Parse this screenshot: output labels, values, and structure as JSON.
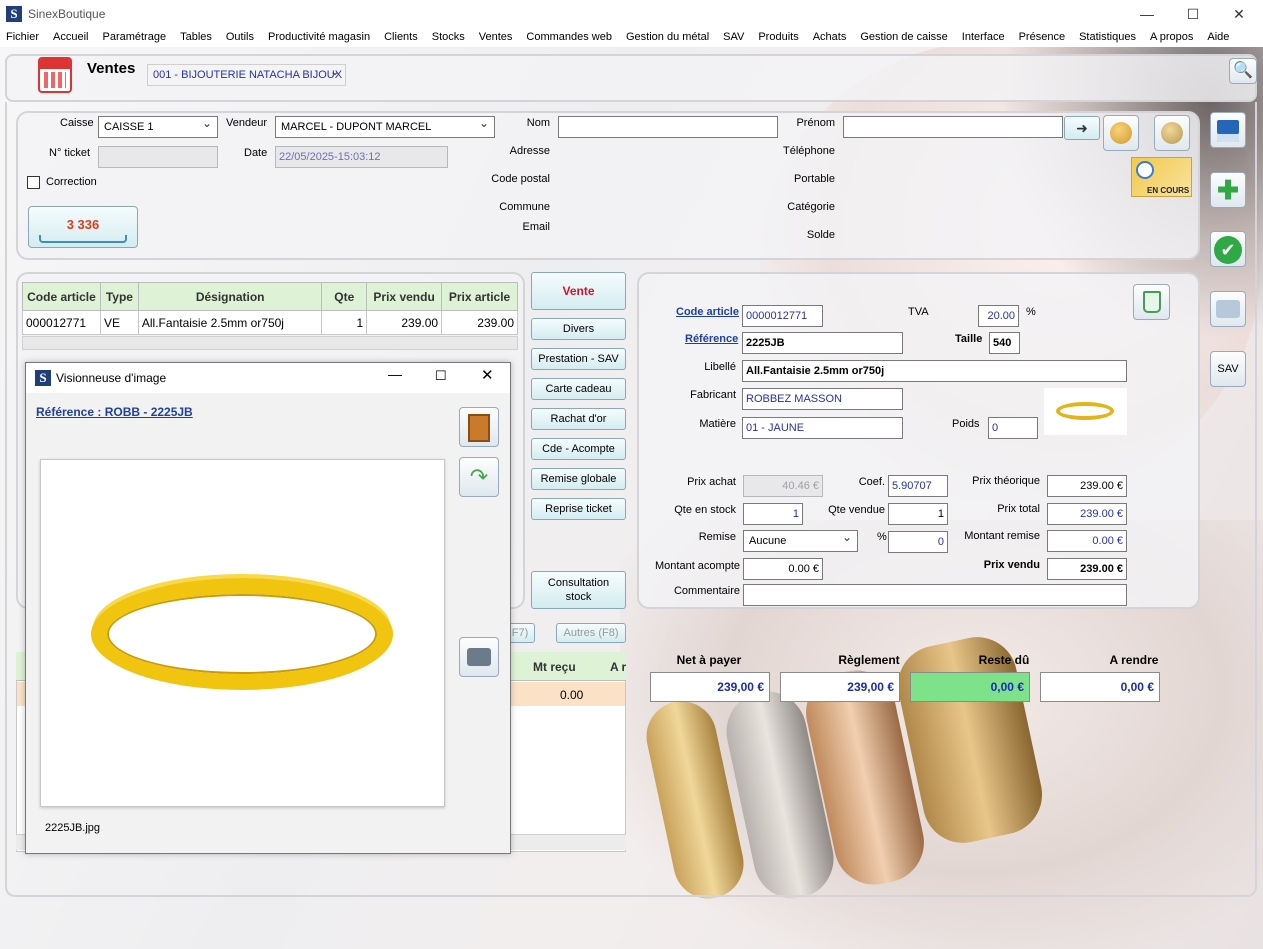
{
  "window": {
    "app_title": "SinexBoutique",
    "minimize": "—",
    "maximize": "☐",
    "close": "✕"
  },
  "menu": [
    "Fichier",
    "Accueil",
    "Paramétrage",
    "Tables",
    "Outils",
    "Productivité magasin",
    "Clients",
    "Stocks",
    "Ventes",
    "Commandes web",
    "Gestion du métal",
    "SAV",
    "Produits",
    "Achats",
    "Gestion de caisse",
    "Interface",
    "Présence",
    "Statistiques",
    "A propos",
    "Aide"
  ],
  "header": {
    "title": "Ventes",
    "store": "001 - BIJOUTERIE NATACHA BIJOUX"
  },
  "ticket": {
    "caisse_label": "Caisse",
    "caisse_value": "CAISSE 1",
    "vendeur_label": "Vendeur",
    "vendeur_value": "MARCEL - DUPONT MARCEL",
    "num_label": "N° ticket",
    "num_value": "",
    "date_label": "Date",
    "date_value": "22/05/2025-15:03:12",
    "correction_label": "Correction",
    "cart_count": "3 336"
  },
  "client": {
    "nom_label": "Nom",
    "prenom_label": "Prénom",
    "adresse_label": "Adresse",
    "telephone_label": "Téléphone",
    "cp_label": "Code postal",
    "portable_label": "Portable",
    "commune_label": "Commune",
    "categorie_label": "Catégorie",
    "email_label": "Email",
    "solde_label": "Solde",
    "en_cours_label": "EN COURS"
  },
  "lines": {
    "headers": [
      "Code article",
      "Type",
      "Désignation",
      "Qte",
      "Prix vendu",
      "Prix article"
    ],
    "rows": [
      [
        "000012771",
        "VE",
        "All.Fantaisie 2.5mm or750j",
        "1",
        "239.00",
        "239.00"
      ]
    ]
  },
  "actions": [
    "Vente",
    "Divers",
    "Prestation - SAV",
    "Carte cadeau",
    "Rachat d'or",
    "Cde - Acompte",
    "Remise globale",
    "Reprise ticket",
    "Consultation stock"
  ],
  "article": {
    "code_label": "Code article",
    "code_value": "0000012771",
    "tva_label": "TVA",
    "tva_value": "20.00",
    "tva_unit": "%",
    "ref_label": "Référence",
    "ref_value": "2225JB",
    "taille_label": "Taille",
    "taille_value": "540",
    "libelle_label": "Libellé",
    "libelle_value": "All.Fantaisie 2.5mm or750j",
    "fabricant_label": "Fabricant",
    "fabricant_value": "ROBBEZ MASSON",
    "matiere_label": "Matière",
    "matiere_value": "01 - JAUNE",
    "poids_label": "Poids",
    "poids_value": "0",
    "prix_achat_label": "Prix achat",
    "prix_achat_value": "40.46 €",
    "coef_label": "Coef.",
    "coef_value": "5.90707",
    "prix_theo_label": "Prix théorique",
    "prix_theo_value": "239.00 €",
    "qte_stock_label": "Qte en stock",
    "qte_stock_value": "1",
    "qte_vendue_label": "Qte vendue",
    "qte_vendue_value": "1",
    "prix_total_label": "Prix total",
    "prix_total_value": "239.00 €",
    "remise_label": "Remise",
    "remise_value": "Aucune",
    "remise_unit": "%",
    "remise_pct": "0",
    "montant_remise_label": "Montant remise",
    "montant_remise_value": "0.00 €",
    "montant_acompte_label": "Montant acompte",
    "montant_acompte_value": "0.00 €",
    "prix_vendu_label": "Prix vendu",
    "prix_vendu_value": "239.00 €",
    "commentaire_label": "Commentaire",
    "commentaire_value": ""
  },
  "payments": {
    "tabs": [
      "F7)",
      "Autres (F8)"
    ],
    "headers": [
      "Mt reçu",
      "A r"
    ],
    "row": [
      "0.00",
      ""
    ]
  },
  "totals": {
    "net_label": "Net à payer",
    "net_value": "239,00 €",
    "reglement_label": "Règlement",
    "reglement_value": "239,00 €",
    "reste_label": "Reste dû",
    "reste_value": "0,00 €",
    "rendre_label": "A rendre",
    "rendre_value": "0,00 €",
    "reste_color": "#7ee28a"
  },
  "sidebar": {
    "sav_label": "SAV"
  },
  "viewer": {
    "title": "Visionneuse d'image",
    "reference": "Référence : ROBB - 2225JB",
    "filename": "2225JB.jpg"
  }
}
